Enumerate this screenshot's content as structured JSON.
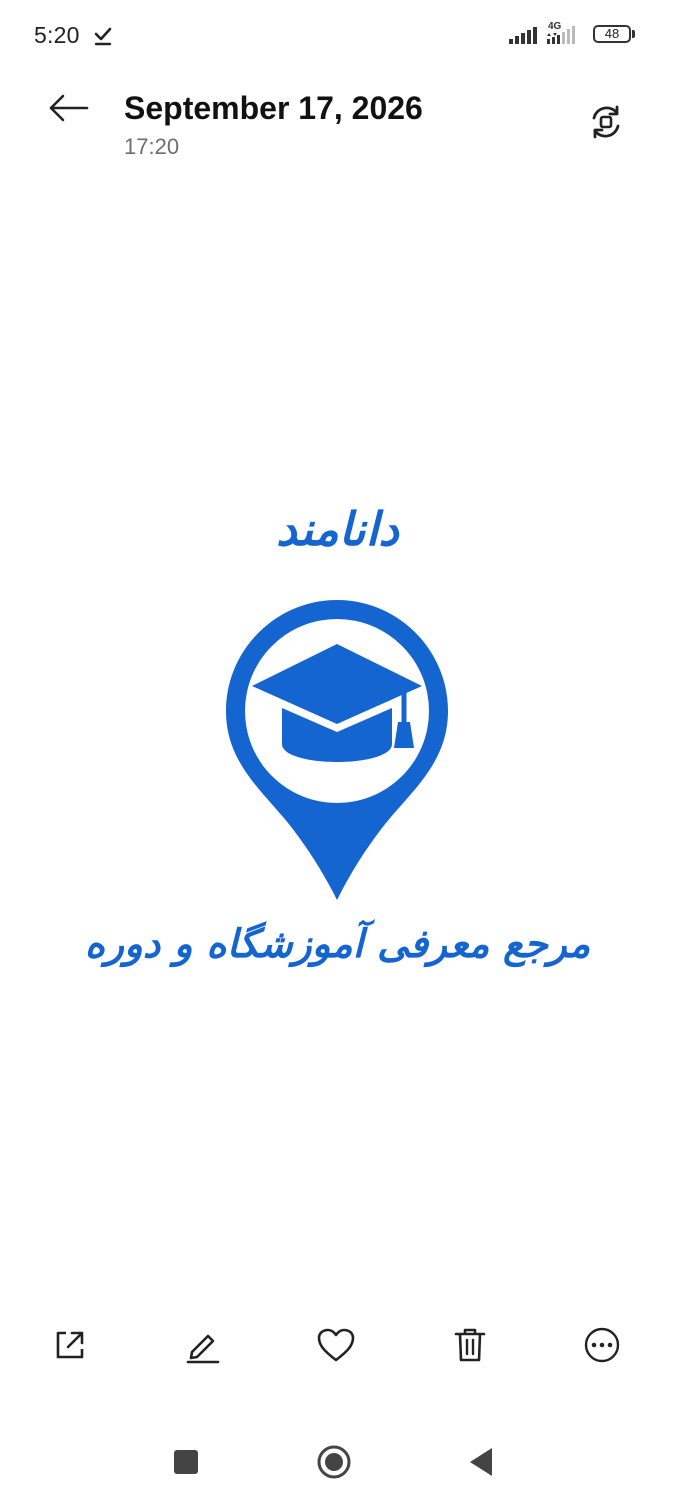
{
  "status_bar": {
    "time": "5:20",
    "network": "4G",
    "battery_level": "48"
  },
  "header": {
    "title": "September 17, 2026",
    "subtitle": "17:20",
    "back_icon": "arrow-left-icon",
    "rotate_icon": "rotate-icon"
  },
  "photo": {
    "top_text": "دانامند",
    "bottom_text": "مرجع معرفی آموزشگاه و دوره",
    "brand_color": "#1565d0"
  },
  "actions": [
    {
      "name": "share",
      "icon": "share-icon"
    },
    {
      "name": "edit",
      "icon": "pencil-icon"
    },
    {
      "name": "favorite",
      "icon": "heart-icon"
    },
    {
      "name": "delete",
      "icon": "trash-icon"
    },
    {
      "name": "more",
      "icon": "more-icon"
    }
  ],
  "nav": [
    {
      "name": "recents",
      "icon": "square-icon"
    },
    {
      "name": "home",
      "icon": "circle-icon"
    },
    {
      "name": "back",
      "icon": "triangle-back-icon"
    }
  ]
}
